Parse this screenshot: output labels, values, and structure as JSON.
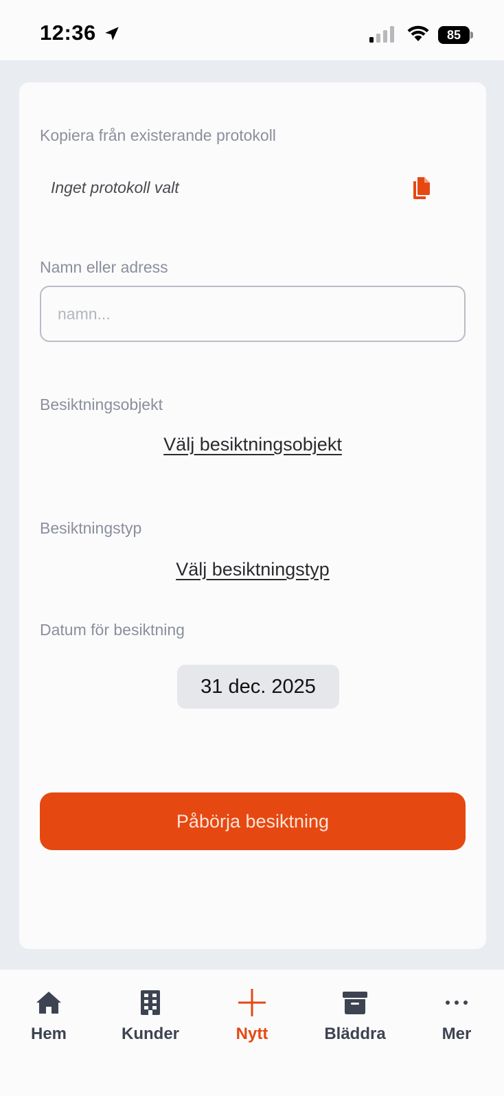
{
  "status_bar": {
    "time": "12:36",
    "battery": "85"
  },
  "form": {
    "copy_label": "Kopiera från existerande protokoll",
    "copy_value": "Inget protokoll valt",
    "name_label": "Namn eller adress",
    "name_placeholder": "namn...",
    "name_value": "",
    "object_label": "Besiktningsobjekt",
    "object_link": "Välj besiktningsobjekt",
    "type_label": "Besiktningstyp",
    "type_link": "Välj besiktningstyp",
    "date_label": "Datum för besiktning",
    "date_value": "31 dec. 2025",
    "start_button": "Påbörja besiktning"
  },
  "colors": {
    "accent": "#e64811",
    "label": "#8b8f9c",
    "tab_inactive": "#3d4350"
  },
  "tabs": [
    {
      "label": "Hem",
      "icon": "home-icon"
    },
    {
      "label": "Kunder",
      "icon": "building-icon"
    },
    {
      "label": "Nytt",
      "icon": "plus-icon",
      "active": true
    },
    {
      "label": "Bläddra",
      "icon": "archive-icon"
    },
    {
      "label": "Mer",
      "icon": "more-icon"
    }
  ]
}
